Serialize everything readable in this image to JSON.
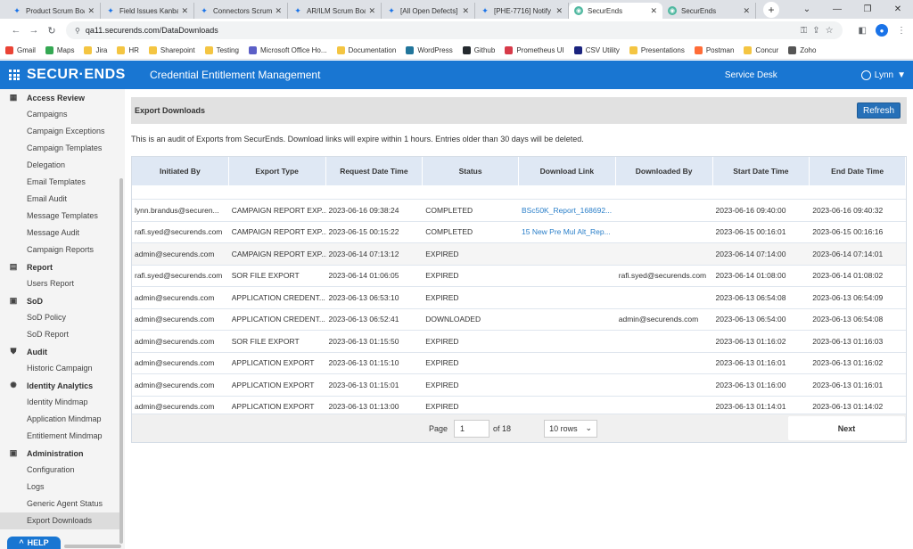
{
  "browser": {
    "tabs": [
      {
        "title": "Product Scrum Boa",
        "icon": "jira-icon"
      },
      {
        "title": "Field Issues Kanbar",
        "icon": "jira-icon"
      },
      {
        "title": "Connectors Scrum",
        "icon": "jira-icon"
      },
      {
        "title": "AR/ILM Scrum Boa",
        "icon": "jira-icon"
      },
      {
        "title": "[All Open Defects]",
        "icon": "jira-icon"
      },
      {
        "title": "[PHE-7716] Notify",
        "icon": "jira-icon"
      },
      {
        "title": "SecurEnds",
        "icon": "securends-icon",
        "active": true
      },
      {
        "title": "SecurEnds",
        "icon": "securends-icon"
      }
    ],
    "url": "qa11.securends.com/DataDownloads",
    "bookmarks": [
      {
        "label": "Gmail",
        "color": "#ea4335"
      },
      {
        "label": "Maps",
        "color": "#34a853"
      },
      {
        "label": "Jira",
        "color": "#f4c542"
      },
      {
        "label": "HR",
        "color": "#f4c542"
      },
      {
        "label": "Sharepoint",
        "color": "#f4c542"
      },
      {
        "label": "Testing",
        "color": "#f4c542"
      },
      {
        "label": "Microsoft Office Ho...",
        "color": "#5b5fc7"
      },
      {
        "label": "Documentation",
        "color": "#f4c542"
      },
      {
        "label": "WordPress",
        "color": "#21759b"
      },
      {
        "label": "Github",
        "color": "#24292e"
      },
      {
        "label": "Prometheus UI",
        "color": "#d73a49"
      },
      {
        "label": "CSV Utility",
        "color": "#1a237e"
      },
      {
        "label": "Presentations",
        "color": "#f4c542"
      },
      {
        "label": "Postman",
        "color": "#ff6c37"
      },
      {
        "label": "Concur",
        "color": "#f4c542"
      },
      {
        "label": "Zoho",
        "color": "#555555"
      }
    ]
  },
  "header": {
    "logo": "SECUR·ENDS",
    "title": "Credential Entitlement Management",
    "service_desk": "Service Desk",
    "user": "Lynn"
  },
  "sidebar": {
    "sections": [
      {
        "label": "Access Review",
        "icon": "grid-icon",
        "items": [
          "Campaigns",
          "Campaign Exceptions",
          "Campaign Templates",
          "Delegation",
          "Email Templates",
          "Email Audit",
          "Message Templates",
          "Message Audit",
          "Campaign Reports"
        ]
      },
      {
        "label": "Report",
        "icon": "report-icon",
        "items": [
          "Users Report"
        ]
      },
      {
        "label": "SoD",
        "icon": "sod-icon",
        "items": [
          "SoD Policy",
          "SoD Report"
        ]
      },
      {
        "label": "Audit",
        "icon": "shield-icon",
        "items": [
          "Historic Campaign"
        ]
      },
      {
        "label": "Identity Analytics",
        "icon": "analytics-icon",
        "items": [
          "Identity Mindmap",
          "Application Mindmap",
          "Entitlement Mindmap"
        ]
      },
      {
        "label": "Administration",
        "icon": "admin-icon",
        "items": [
          "Configuration",
          "Logs",
          "Generic Agent Status",
          "Export Downloads"
        ]
      }
    ],
    "active_item": "Export Downloads",
    "help": "HELP"
  },
  "panel": {
    "title": "Export Downloads",
    "refresh": "Refresh",
    "note": "This is an audit of Exports from SecurEnds. Download links will expire within 1 hours. Entries older than 30 days will be deleted."
  },
  "table": {
    "columns": [
      "Initiated By",
      "Export Type",
      "Request Date Time",
      "Status",
      "Download Link",
      "Downloaded By",
      "Start Date Time",
      "End Date Time"
    ],
    "rows": [
      [
        "lynn.brandus@securen...",
        "CAMPAIGN REPORT EXP...",
        "2023-06-16 09:38:24",
        "COMPLETED",
        "BSc50K_Report_168692...",
        "",
        "2023-06-16 09:40:00",
        "2023-06-16 09:40:32"
      ],
      [
        "rafi.syed@securends.com",
        "CAMPAIGN REPORT EXP...",
        "2023-06-15 00:15:22",
        "COMPLETED",
        "15 New Pre Mul Alt_Rep...",
        "",
        "2023-06-15 00:16:01",
        "2023-06-15 00:16:16"
      ],
      [
        "admin@securends.com",
        "CAMPAIGN REPORT EXP...",
        "2023-06-14 07:13:12",
        "EXPIRED",
        "",
        "",
        "2023-06-14 07:14:00",
        "2023-06-14 07:14:01"
      ],
      [
        "rafi.syed@securends.com",
        "SOR FILE EXPORT",
        "2023-06-14 01:06:05",
        "EXPIRED",
        "",
        "rafi.syed@securends.com",
        "2023-06-14 01:08:00",
        "2023-06-14 01:08:02"
      ],
      [
        "admin@securends.com",
        "APPLICATION CREDENT...",
        "2023-06-13 06:53:10",
        "EXPIRED",
        "",
        "",
        "2023-06-13 06:54:08",
        "2023-06-13 06:54:09"
      ],
      [
        "admin@securends.com",
        "APPLICATION CREDENT...",
        "2023-06-13 06:52:41",
        "DOWNLOADED",
        "",
        "admin@securends.com",
        "2023-06-13 06:54:00",
        "2023-06-13 06:54:08"
      ],
      [
        "admin@securends.com",
        "SOR FILE EXPORT",
        "2023-06-13 01:15:50",
        "EXPIRED",
        "",
        "",
        "2023-06-13 01:16:02",
        "2023-06-13 01:16:03"
      ],
      [
        "admin@securends.com",
        "APPLICATION EXPORT",
        "2023-06-13 01:15:10",
        "EXPIRED",
        "",
        "",
        "2023-06-13 01:16:01",
        "2023-06-13 01:16:02"
      ],
      [
        "admin@securends.com",
        "APPLICATION EXPORT",
        "2023-06-13 01:15:01",
        "EXPIRED",
        "",
        "",
        "2023-06-13 01:16:00",
        "2023-06-13 01:16:01"
      ],
      [
        "admin@securends.com",
        "APPLICATION EXPORT",
        "2023-06-13 01:13:00",
        "EXPIRED",
        "",
        "",
        "2023-06-13 01:14:01",
        "2023-06-13 01:14:02"
      ]
    ]
  },
  "pager": {
    "page_label": "Page",
    "page_value": "1",
    "of_label": "of 18",
    "rows_option": "10 rows",
    "next": "Next"
  },
  "colors": {
    "header_bg": "#1976d2",
    "link": "#2a7fc9",
    "table_header_bg": "#dfe8f4"
  }
}
